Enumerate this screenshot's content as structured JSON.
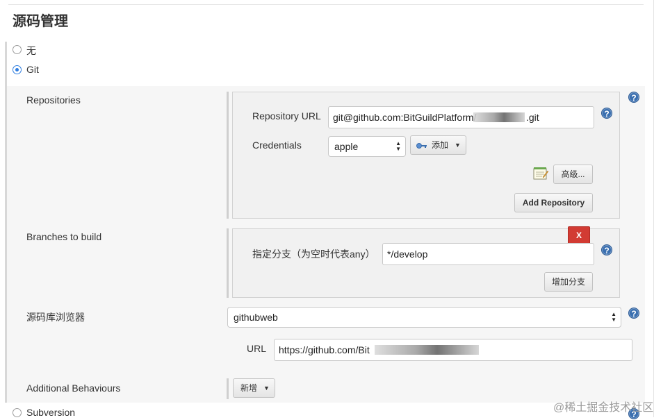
{
  "section": {
    "title": "源码管理"
  },
  "scm_options": {
    "none": "无",
    "git": "Git",
    "subversion": "Subversion"
  },
  "repositories": {
    "label": "Repositories",
    "url_label": "Repository URL",
    "url_value": "git@github.com:BitGuildPlatform/",
    "url_suffix": ".git",
    "credentials_label": "Credentials",
    "credentials_value": "apple",
    "add_button": "添加",
    "advanced_button": "高级...",
    "add_repository_button": "Add Repository"
  },
  "branches": {
    "label": "Branches to build",
    "branch_label": "指定分支（为空时代表any）",
    "branch_value": "*/develop",
    "delete_button": "X",
    "add_branch_button": "增加分支"
  },
  "browser": {
    "label": "源码库浏览器",
    "value": "githubweb",
    "url_label": "URL",
    "url_value": "https://github.com/Bit"
  },
  "behaviours": {
    "label": "Additional Behaviours",
    "add_button": "新增"
  },
  "help_icon_text": "?",
  "watermark": "@稀土掘金技术社区",
  "colors": {
    "accent": "#2f7ee0",
    "delete": "#d23b33",
    "help": "#3a6fb0"
  }
}
